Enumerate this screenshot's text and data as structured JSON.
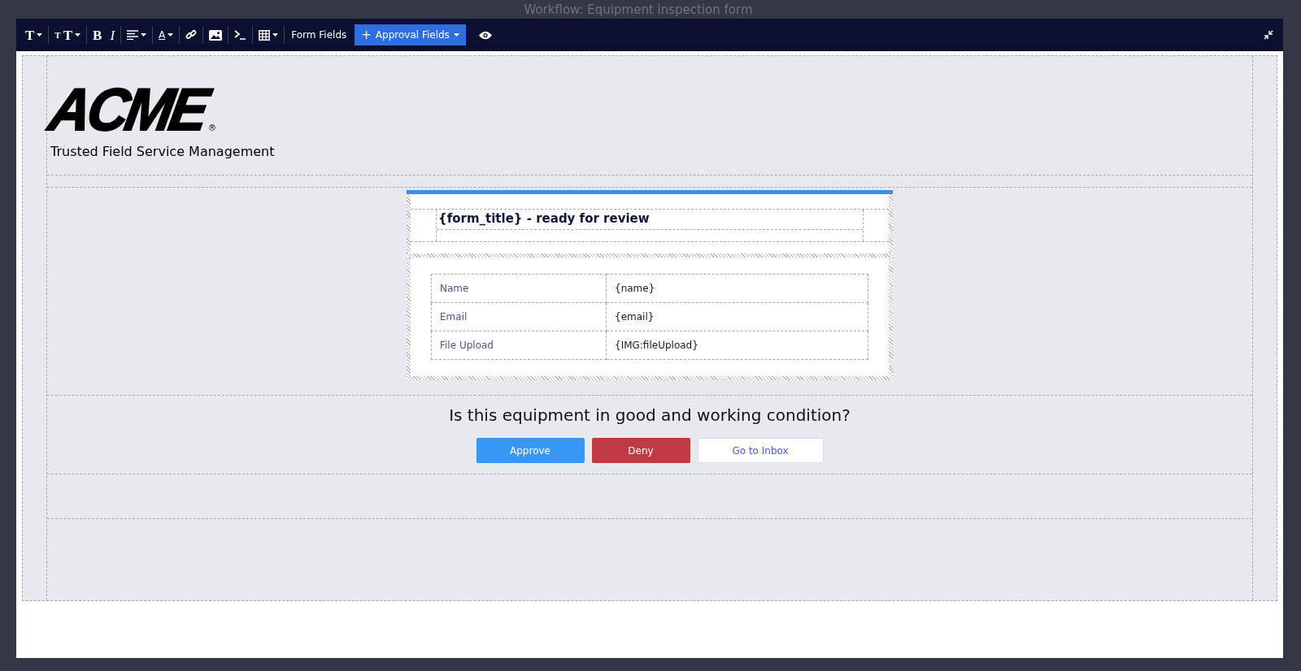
{
  "background": {
    "title": "Workflow: Equipment inspection form"
  },
  "toolbar": {
    "tools": [
      {
        "kind": "heading",
        "text": "T"
      },
      {
        "kind": "font-size",
        "small": "T",
        "large": "T"
      },
      {
        "kind": "bold",
        "text": "B"
      },
      {
        "kind": "italic",
        "text": "I"
      },
      {
        "kind": "align"
      },
      {
        "kind": "text-color",
        "text": "A"
      },
      {
        "kind": "link"
      },
      {
        "kind": "image"
      },
      {
        "kind": "code"
      },
      {
        "kind": "table"
      }
    ],
    "form_fields": "Form Fields",
    "approval_fields": {
      "icon": "+",
      "label": "Approval Fields"
    }
  },
  "template": {
    "logo": "ACME",
    "registered": "®",
    "tagline": "Trusted Field Service Management",
    "card": {
      "title": "{form_title} - ready for review",
      "rows": [
        {
          "label": "Name",
          "value": "{name}"
        },
        {
          "label": "Email",
          "value": "{email}"
        },
        {
          "label": "File Upload",
          "value": "{IMG:fileUpload}"
        }
      ]
    },
    "question": "Is this equipment in good and working condition?",
    "buttons": [
      {
        "kind": "primary",
        "label": "Approve"
      },
      {
        "kind": "danger",
        "label": "Deny"
      },
      {
        "kind": "link",
        "label": "Go to Inbox"
      }
    ]
  }
}
